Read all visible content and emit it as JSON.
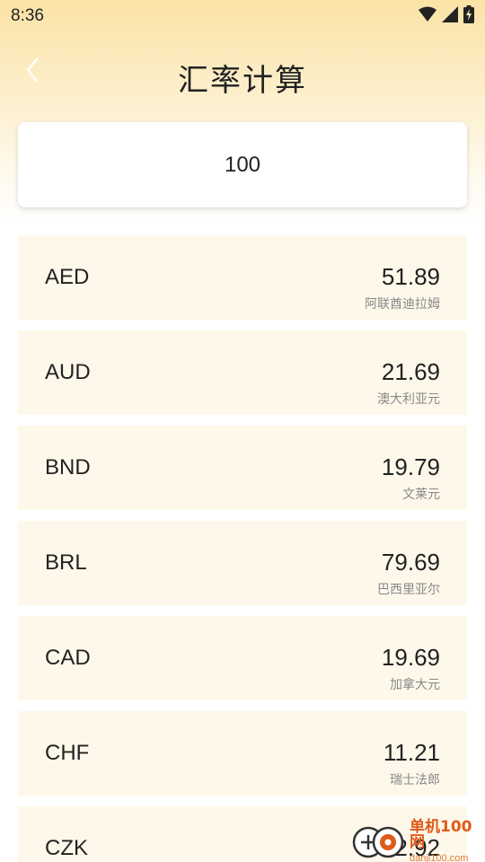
{
  "status_bar": {
    "time": "8:36"
  },
  "header": {
    "title": "汇率计算"
  },
  "amount": {
    "value": "100"
  },
  "rates": [
    {
      "code": "AED",
      "value": "51.89",
      "name": "阿联酋迪拉姆"
    },
    {
      "code": "AUD",
      "value": "21.69",
      "name": "澳大利亚元"
    },
    {
      "code": "BND",
      "value": "19.79",
      "name": "文莱元"
    },
    {
      "code": "BRL",
      "value": "79.69",
      "name": "巴西里亚尔"
    },
    {
      "code": "CAD",
      "value": "19.69",
      "name": "加拿大元"
    },
    {
      "code": "CHF",
      "value": "11.21",
      "name": "瑞士法郎"
    },
    {
      "code": "CZK",
      "value": "32.92",
      "name": ""
    }
  ],
  "watermark": {
    "title": "单机100网",
    "subtitle": "danji100.com"
  },
  "colors": {
    "header_gradient_top": "#fbe3a6",
    "row_background": "#fef8ea",
    "watermark": "#e05a1a"
  },
  "icons": [
    "wifi-icon",
    "signal-icon",
    "battery-charging-icon",
    "back-arrow-icon"
  ]
}
